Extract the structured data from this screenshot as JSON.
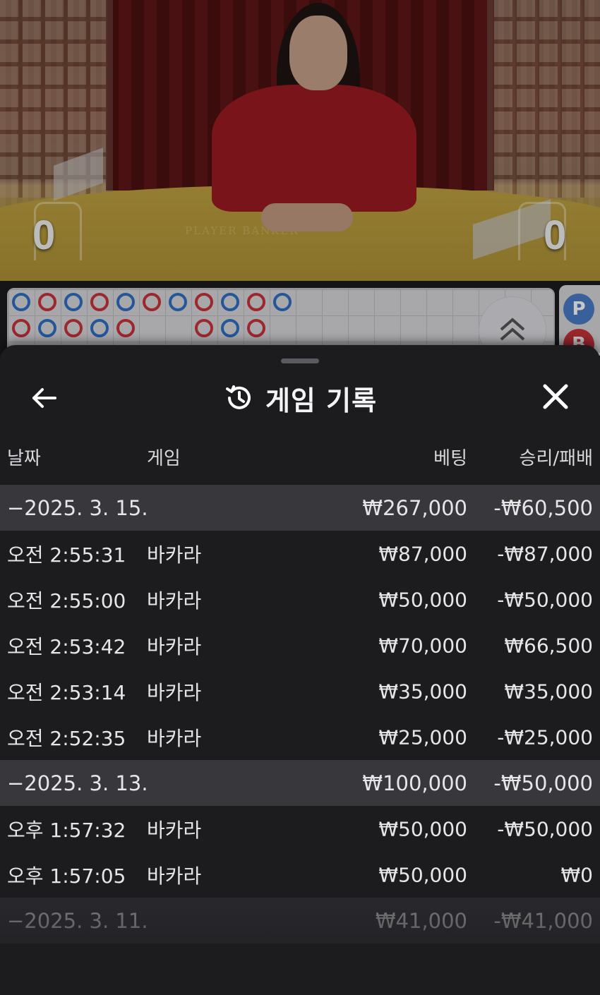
{
  "video": {
    "player_score": "0",
    "banker_score": "0",
    "felt_text": "PLAYER  BANKER"
  },
  "roadmap": {
    "columns": [
      [
        "P",
        "B"
      ],
      [
        "B",
        "P"
      ],
      [
        "P",
        "B"
      ],
      [
        "B",
        "P"
      ],
      [
        "P",
        "B"
      ],
      [
        "B"
      ],
      [
        "P"
      ],
      [
        "B",
        "B"
      ],
      [
        "P",
        "P"
      ],
      [
        "B",
        "B"
      ],
      [
        "P"
      ]
    ],
    "colors": {
      "player": "#2f6fc6",
      "banker": "#c8323a"
    },
    "side_pills": [
      {
        "label": "P",
        "color": "#4a7cc6"
      },
      {
        "label": "B",
        "color": "#c8323a"
      }
    ],
    "expand_icon": "double-chevron-up-icon"
  },
  "sheet": {
    "title": "게임 기록",
    "title_icon": "history-icon",
    "back_icon": "back-arrow-icon",
    "close_icon": "close-icon"
  },
  "columns": {
    "date": "날짜",
    "game": "게임",
    "bet": "베팅",
    "winloss": "승리/패배"
  },
  "groups": [
    {
      "date": "−2025. 3. 15.",
      "bet": "₩267,000",
      "winloss": "-₩60,500",
      "rows": [
        {
          "time": "오전 2:55:31",
          "game": "바카라",
          "bet": "₩87,000",
          "winloss": "-₩87,000"
        },
        {
          "time": "오전 2:55:00",
          "game": "바카라",
          "bet": "₩50,000",
          "winloss": "-₩50,000"
        },
        {
          "time": "오전 2:53:42",
          "game": "바카라",
          "bet": "₩70,000",
          "winloss": "₩66,500"
        },
        {
          "time": "오전 2:53:14",
          "game": "바카라",
          "bet": "₩35,000",
          "winloss": "₩35,000"
        },
        {
          "time": "오전 2:52:35",
          "game": "바카라",
          "bet": "₩25,000",
          "winloss": "-₩25,000"
        }
      ]
    },
    {
      "date": "−2025. 3. 13.",
      "bet": "₩100,000",
      "winloss": "-₩50,000",
      "rows": [
        {
          "time": "오후 1:57:32",
          "game": "바카라",
          "bet": "₩50,000",
          "winloss": "-₩50,000"
        },
        {
          "time": "오후 1:57:05",
          "game": "바카라",
          "bet": "₩50,000",
          "winloss": "₩0"
        }
      ]
    },
    {
      "date": "−2025. 3. 11.",
      "bet": "₩41,000",
      "winloss": "-₩41,000",
      "rows": []
    }
  ]
}
